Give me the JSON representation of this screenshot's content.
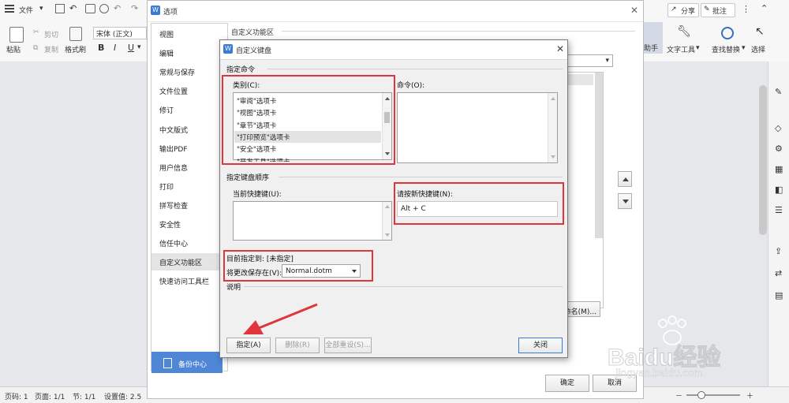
{
  "ribbon": {
    "file_menu": "文件",
    "paste": "粘贴",
    "cut": "剪切",
    "copy": "复制",
    "format_painter": "格式刷",
    "font_name": "宋体 (正文)",
    "share": "分享",
    "annotate": "批注",
    "assistant": "助手",
    "text_tools": "文字工具",
    "find_replace": "查找替换",
    "select": "选择"
  },
  "status_bar": {
    "page_num": "页码: 1",
    "pages": "页面: 1/1",
    "section": "节: 1/1",
    "setting": "设置值: 2.5"
  },
  "options_dialog": {
    "title": "选项",
    "nav": [
      "视图",
      "编辑",
      "常规与保存",
      "文件位置",
      "修订",
      "中文版式",
      "输出PDF",
      "用户信息",
      "打印",
      "拼写检查",
      "安全性",
      "信任中心",
      "自定义功能区",
      "快速访问工具栏"
    ],
    "active_index": 12,
    "section_title": "自定义功能区",
    "rename_button": "重命名(M)...",
    "backup_center": "备份中心",
    "ok_button": "确定",
    "cancel_button": "取消"
  },
  "keyboard_dialog": {
    "title": "自定义键盘",
    "specify_command": "指定命令",
    "category_label": "类别(C):",
    "categories": [
      "\"审阅\"选项卡",
      "\"视图\"选项卡",
      "\"章节\"选项卡",
      "\"打印预览\"选项卡",
      "\"安全\"选项卡",
      "\"开发工具\"选项卡"
    ],
    "selected_category_index": 3,
    "command_label": "命令(O):",
    "key_sequence_title": "指定键盘顺序",
    "current_keys_label": "当前快捷键(U):",
    "new_key_label": "请按新快捷键(N):",
    "new_key_value": "Alt + C",
    "currently_assigned": "目前指定到: [未指定]",
    "save_changes_in_label": "将更改保存在(V):",
    "save_changes_in_value": "Normal.dotm",
    "description_title": "说明",
    "assign_button": "指定(A)",
    "remove_button": "删除(R)",
    "reset_all_button": "全部重设(S)...",
    "close_button": "关闭"
  },
  "watermark": {
    "brand": "Baidu经验",
    "url": "jingyan.baidu.com"
  },
  "colors": {
    "highlight": "#e0353a",
    "accent_blue": "#3a7bd5",
    "backup_blue": "#4f86d6"
  }
}
